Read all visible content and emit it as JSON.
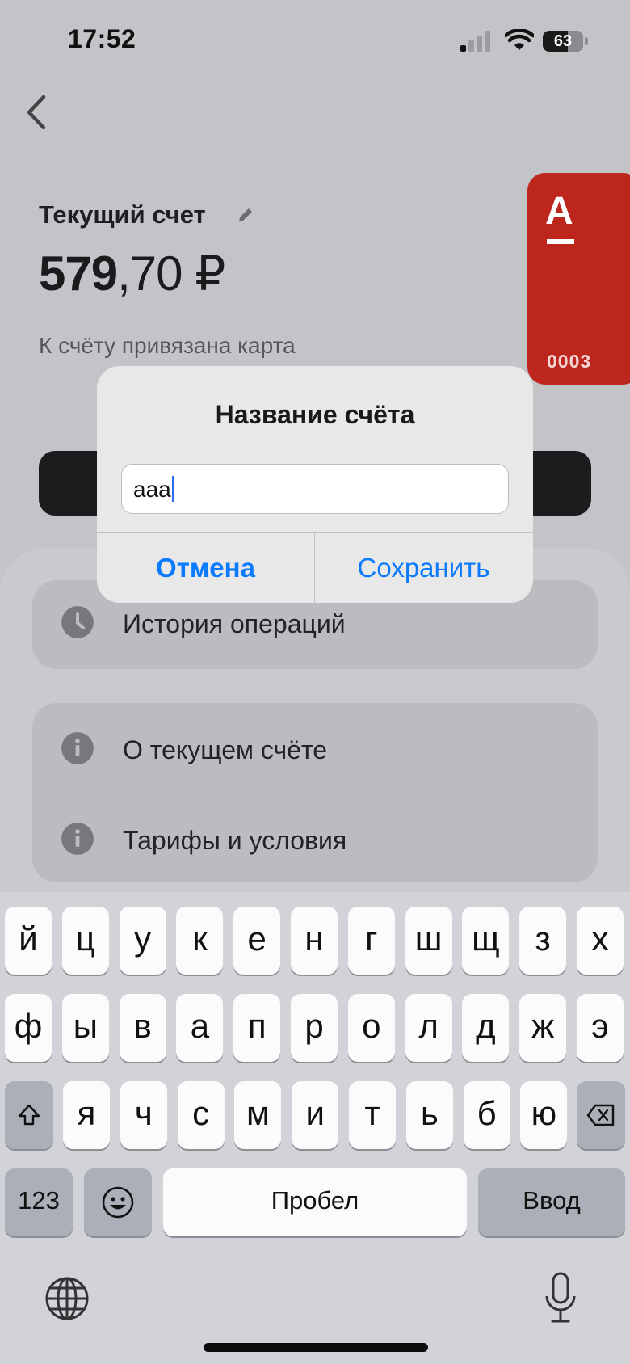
{
  "status_bar": {
    "time": "17:52",
    "battery": "63",
    "battery_level": 0.63
  },
  "account": {
    "title": "Текущий счет",
    "balance_int": "579",
    "balance_frac": ",70",
    "currency": "₽",
    "linked_text": "К счёту привязана карта"
  },
  "card": {
    "logo": "А",
    "last_digits": "0003",
    "color": "#bd261d"
  },
  "menu": {
    "history": "История операций",
    "about": "О текущем счёте",
    "tariffs": "Тарифы и условия"
  },
  "dialog": {
    "title": "Название счёта",
    "input_value": "aaa",
    "cancel": "Отмена",
    "save": "Сохранить",
    "accent_color": "#0a7aff"
  },
  "keyboard": {
    "row1": [
      "й",
      "ц",
      "у",
      "к",
      "е",
      "н",
      "г",
      "ш",
      "щ",
      "з",
      "х"
    ],
    "row2": [
      "ф",
      "ы",
      "в",
      "а",
      "п",
      "р",
      "о",
      "л",
      "д",
      "ж",
      "э"
    ],
    "row3": [
      "я",
      "ч",
      "с",
      "м",
      "и",
      "т",
      "ь",
      "б",
      "ю"
    ],
    "numbers": "123",
    "space": "Пробел",
    "enter": "Ввод",
    "icons": [
      "shift-icon",
      "backspace-icon",
      "emoji-icon",
      "globe-icon",
      "microphone-icon"
    ]
  }
}
